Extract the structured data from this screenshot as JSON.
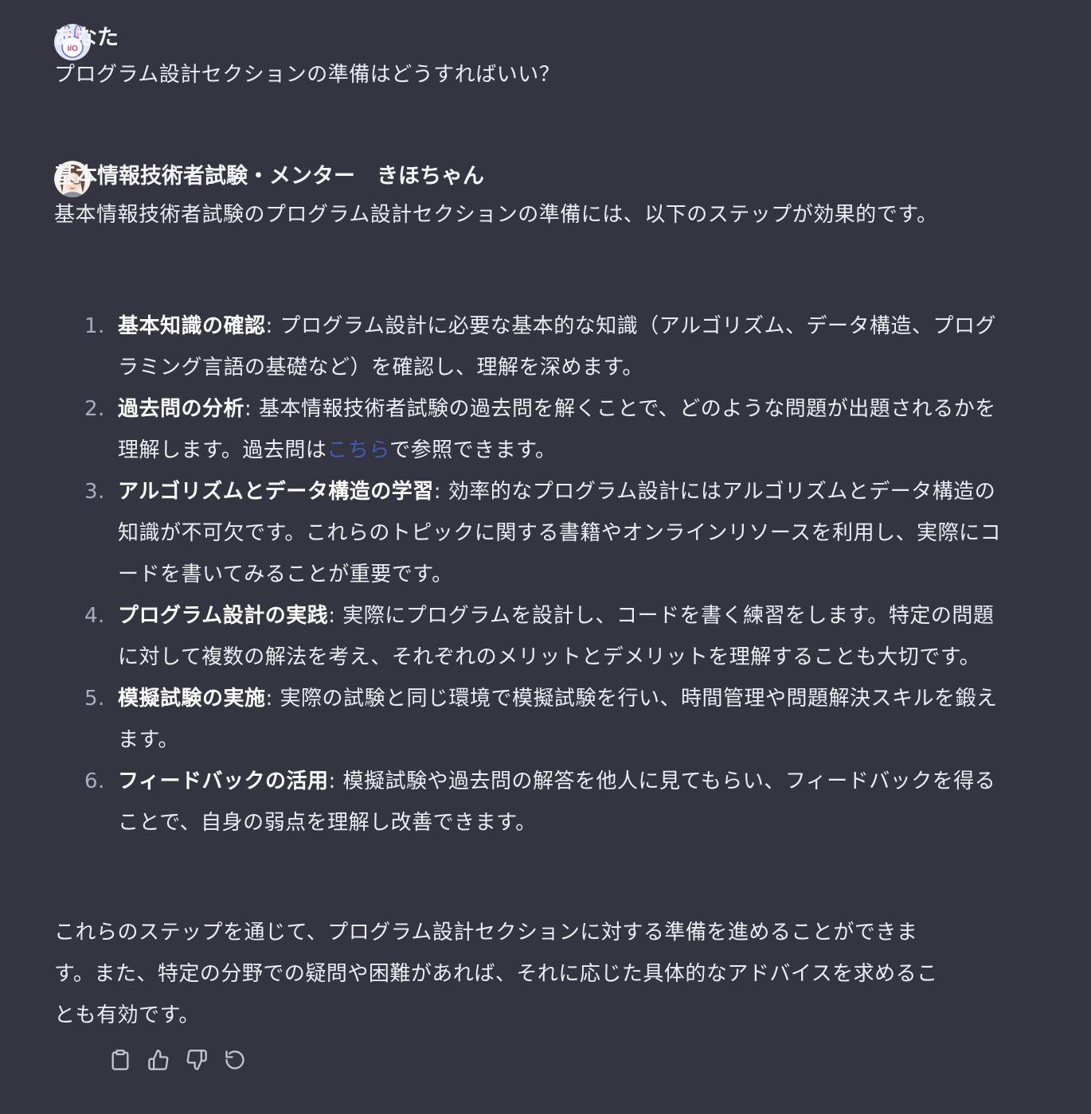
{
  "user_message": {
    "author": "あなた",
    "text": "プログラム設計セクションの準備はどうすればいい？",
    "avatar_label": "I/O"
  },
  "assistant_message": {
    "author": "基本情報技術者試験・メンター　きほちゃん",
    "intro": "基本情報技術者試験のプログラム設計セクションの準備には、以下のステップが効果的です。",
    "steps": [
      {
        "number": "1.",
        "title": "基本知識の確認",
        "body": ": プログラム設計に必要な基本的な知識（アルゴリズム、データ構造、プログラミング言語の基礎など）を確認し、理解を深めます。"
      },
      {
        "number": "2.",
        "title": "過去問の分析",
        "body_before_link": ": 基本情報技術者試験の過去問を解くことで、どのような問題が出題されるかを理解します。過去問は",
        "link_text": "こちら",
        "body_after_link": "で参照できます。"
      },
      {
        "number": "3.",
        "title": "アルゴリズムとデータ構造の学習",
        "body": ": 効率的なプログラム設計にはアルゴリズムとデータ構造の知識が不可欠です。これらのトピックに関する書籍やオンラインリソースを利用し、実際にコードを書いてみることが重要です。"
      },
      {
        "number": "4.",
        "title": "プログラム設計の実践",
        "body": ": 実際にプログラムを設計し、コードを書く練習をします。特定の問題に対して複数の解法を考え、それぞれのメリットとデメリットを理解することも大切です。"
      },
      {
        "number": "5.",
        "title": "模擬試験の実施",
        "body": ": 実際の試験と同じ環境で模擬試験を行い、時間管理や問題解決スキルを鍛えます。"
      },
      {
        "number": "6.",
        "title": "フィードバックの活用",
        "body": ": 模擬試験や過去問の解答を他人に見てもらい、フィードバックを得ることで、自身の弱点を理解し改善できます。"
      }
    ],
    "outro": "これらのステップを通じて、プログラム設計セクションに対する準備を進めることができます。また、特定の分野での疑問や困難があれば、それに応じた具体的なアドバイスを求めることも有効です。"
  },
  "actions": [
    "clipboard-icon",
    "thumbs-up-icon",
    "thumbs-down-icon",
    "regenerate-icon"
  ],
  "colors": {
    "background": "#343541",
    "text": "#ececf1",
    "link": "#3b5fb0",
    "icon": "#c5c5d2"
  }
}
